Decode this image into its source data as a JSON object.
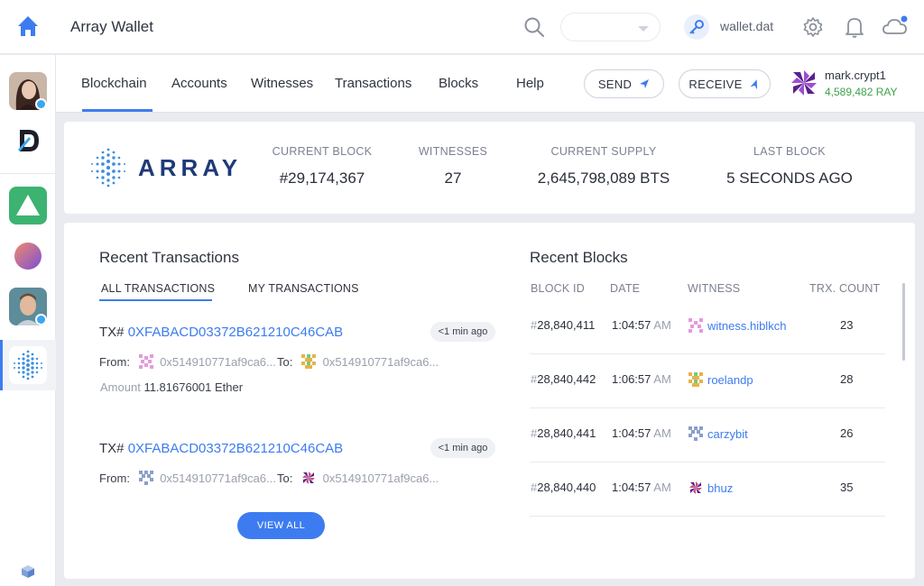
{
  "header": {
    "app_title": "Array Wallet",
    "wallet_file": "wallet.dat",
    "select_value": ""
  },
  "nav": {
    "tabs": [
      "Blockchain",
      "Accounts",
      "Witnesses",
      "Transactions",
      "Blocks",
      "Help"
    ],
    "active_tab": "Blockchain",
    "send_label": "SEND",
    "receive_label": "RECEIVE"
  },
  "user": {
    "name": "mark.crypt1",
    "balance": "4,589,482 RAY"
  },
  "stats": {
    "logo_text": "ARRAY",
    "items": [
      {
        "label": "CURRENT BLOCK",
        "value": "#29,174,367"
      },
      {
        "label": "WITNESSES",
        "value": "27"
      },
      {
        "label": "CURRENT SUPPLY",
        "value": "2,645,798,089 BTS"
      },
      {
        "label": "LAST BLOCK",
        "value": "5 SECONDS AGO"
      }
    ]
  },
  "transactions": {
    "title": "Recent Transactions",
    "tabs": [
      "ALL TRANSACTIONS",
      "MY TRANSACTIONS"
    ],
    "items": [
      {
        "tx_label": "TX#",
        "hash": "0XFABACD03372B621210C46CAB",
        "time": "<1 min ago",
        "from_label": "From:",
        "from": "0x514910771af9ca6...",
        "to_label": "To:",
        "to": "0x514910771af9ca6...",
        "amount_label": "Amount",
        "amount": "11.81676001 Ether"
      },
      {
        "tx_label": "TX#",
        "hash": "0XFABACD03372B621210C46CAB",
        "time": "<1 min ago",
        "from_label": "From:",
        "from": "0x514910771af9ca6...",
        "to_label": "To:",
        "to": "0x514910771af9ca6..."
      }
    ],
    "view_all": "VIEW ALL"
  },
  "blocks": {
    "title": "Recent Blocks",
    "columns": [
      "BLOCK ID",
      "DATE",
      "WITNESS",
      "TRX. COUNT"
    ],
    "rows": [
      {
        "hash": "#",
        "id": "28,840,411",
        "time": "1:04:57",
        "ampm": "AM",
        "witness": "witness.hiblkch",
        "count": "23"
      },
      {
        "hash": "#",
        "id": "28,840,442",
        "time": "1:06:57",
        "ampm": "AM",
        "witness": "roelandp",
        "count": "28"
      },
      {
        "hash": "#",
        "id": "28,840,441",
        "time": "1:04:57",
        "ampm": "AM",
        "witness": "carzybit",
        "count": "26"
      },
      {
        "hash": "#",
        "id": "28,840,440",
        "time": "1:04:57",
        "ampm": "AM",
        "witness": "bhuz",
        "count": "35"
      }
    ]
  },
  "colors": {
    "accent": "#3d7cf0",
    "balance_green": "#3fa24b",
    "logo_navy": "#1f3a78"
  },
  "icons": [
    "home-icon",
    "search-icon",
    "key-icon",
    "gear-icon",
    "bell-icon",
    "cloud-icon",
    "send-arrow-icon",
    "receive-arrow-icon",
    "cube-icon"
  ]
}
